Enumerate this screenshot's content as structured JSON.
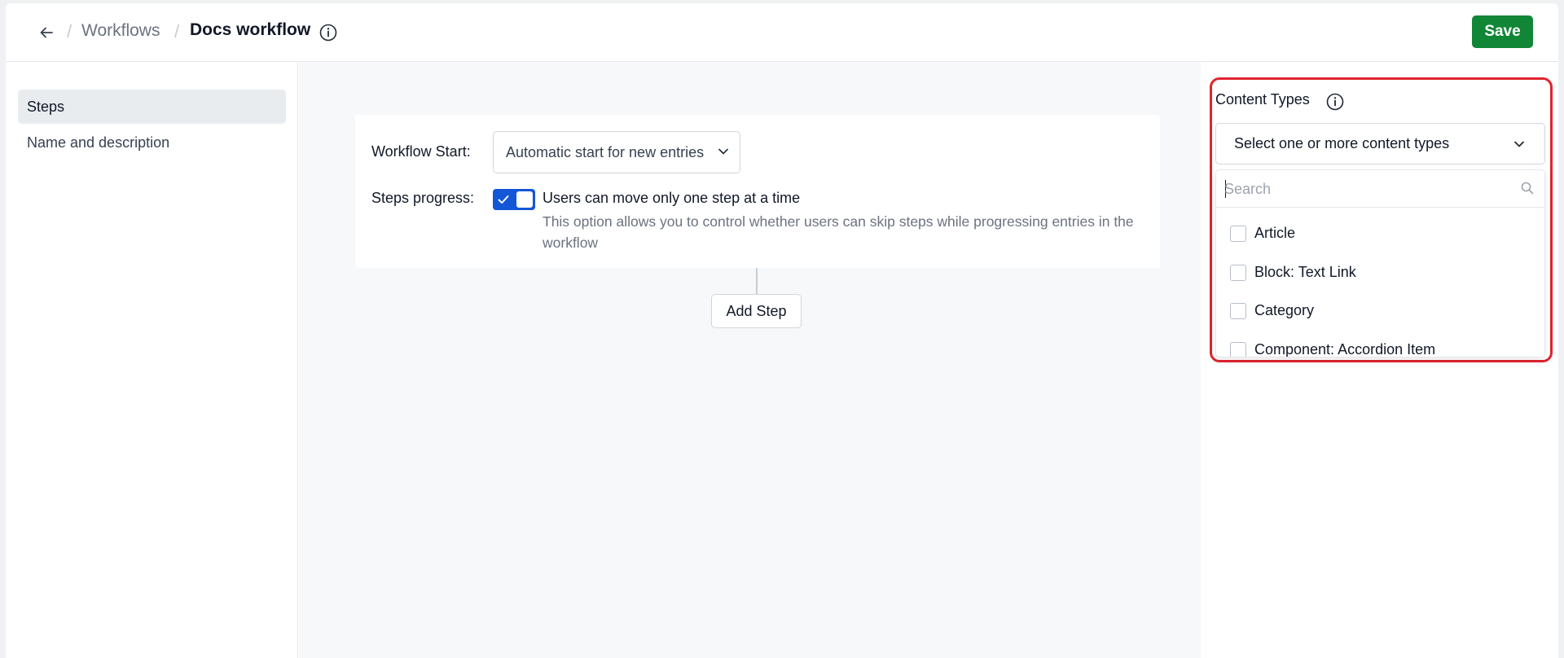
{
  "header": {
    "breadcrumb_parent": "Workflows",
    "title": "Docs workflow",
    "save_label": "Save",
    "separator": "/"
  },
  "sidebar": {
    "items": [
      {
        "label": "Steps",
        "active": true
      },
      {
        "label": "Name and description",
        "active": false
      }
    ]
  },
  "settings": {
    "start_label": "Workflow Start:",
    "start_value": "Automatic start for new entries",
    "progress_label": "Steps progress:",
    "toggle_on": true,
    "toggle_title": "Users can move only one step at a time",
    "toggle_help": "This option allows you to control whether users can skip steps while progressing entries in the workflow"
  },
  "add_step_label": "Add Step",
  "content_types": {
    "label": "Content Types",
    "select_placeholder": "Select one or more content types",
    "search_placeholder": "Search",
    "options": [
      {
        "label": "Article",
        "checked": false
      },
      {
        "label": "Block: Text Link",
        "checked": false
      },
      {
        "label": "Category",
        "checked": false
      },
      {
        "label": "Component: Accordion Item",
        "checked": false
      }
    ]
  },
  "colors": {
    "save": "#118636",
    "toggle": "#1356d6",
    "highlight": "#e0242f"
  }
}
